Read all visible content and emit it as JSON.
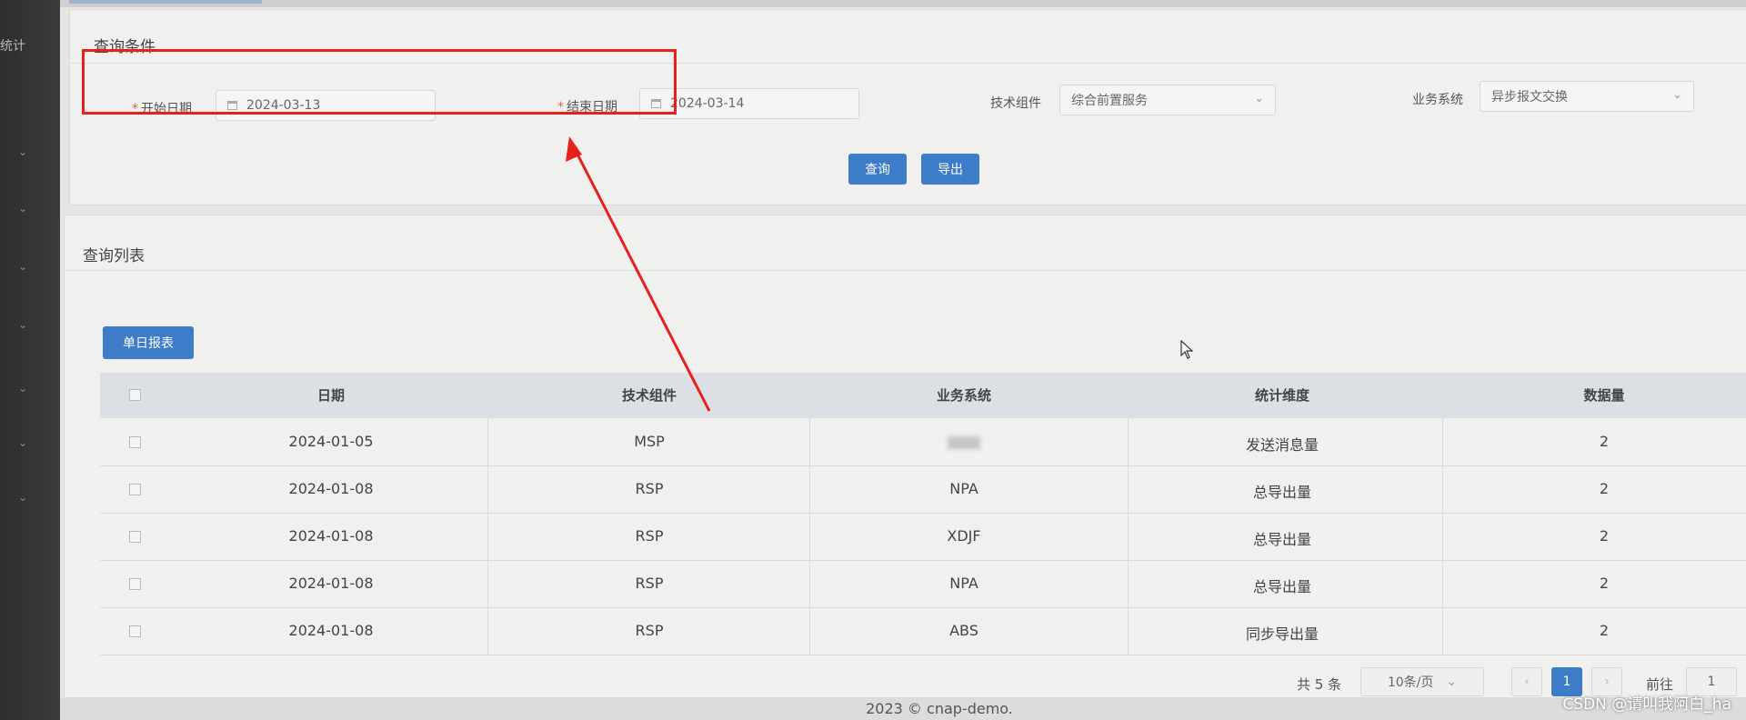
{
  "sidebar": {
    "nav_label": "统计"
  },
  "query_card": {
    "title": "查询条件",
    "start_date": {
      "label": "开始日期",
      "value": "2024-03-13"
    },
    "end_date": {
      "label": "结束日期",
      "value": "2024-03-14"
    },
    "tech_component": {
      "label": "技术组件",
      "value": "综合前置服务"
    },
    "business_system": {
      "label": "业务系统",
      "value": "异步报文交换"
    },
    "query_button": "查询",
    "export_button": "导出"
  },
  "list_card": {
    "title": "查询列表",
    "daily_report_button": "单日报表",
    "columns": [
      "日期",
      "技术组件",
      "业务系统",
      "统计维度",
      "数据量"
    ],
    "rows": [
      {
        "date": "2024-01-05",
        "component": "MSP",
        "system": "",
        "dimension": "发送消息量",
        "count": "2"
      },
      {
        "date": "2024-01-08",
        "component": "RSP",
        "system": "NPA",
        "dimension": "总导出量",
        "count": "2"
      },
      {
        "date": "2024-01-08",
        "component": "RSP",
        "system": "XDJF",
        "dimension": "总导出量",
        "count": "2"
      },
      {
        "date": "2024-01-08",
        "component": "RSP",
        "system": "NPA",
        "dimension": "总导出量",
        "count": "2"
      },
      {
        "date": "2024-01-08",
        "component": "RSP",
        "system": "ABS",
        "dimension": "同步导出量",
        "count": "2"
      }
    ]
  },
  "pagination": {
    "total": "共 5 条",
    "page_size": "10条/页",
    "current_page": "1",
    "goto_label": "前往",
    "goto_value": "1"
  },
  "footer": {
    "text": "2023 © cnap-demo."
  },
  "watermark": "CSDN @请叫我阿白_ha",
  "colors": {
    "primary_button": "#3c7cc8",
    "annotation": "#e8201c"
  }
}
